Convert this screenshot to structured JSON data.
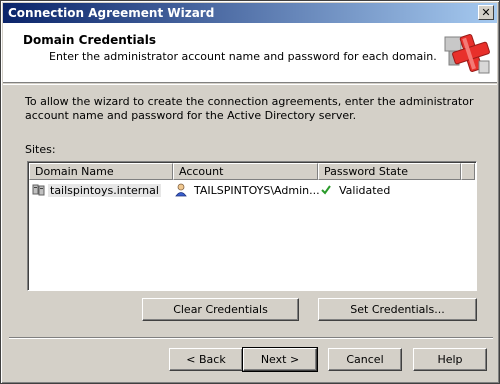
{
  "window": {
    "title": "Connection Agreement Wizard",
    "close_glyph": "✕"
  },
  "header": {
    "title": "Domain Credentials",
    "subtitle": "Enter the administrator account name and password for each domain.",
    "logo_icon": "exchange-wizard-logo-icon"
  },
  "body": {
    "instructions": "To allow the wizard to create the connection agreements, enter the administrator account name and password for the Active Directory server.",
    "sites_label": "Sites:"
  },
  "list": {
    "columns": [
      "Domain Name",
      "Account",
      "Password State"
    ],
    "rows": [
      {
        "domain": "tailspintoys.internal",
        "account": "TAILSPINTOYS\\Admin...",
        "state": "Validated",
        "domain_icon": "domain-icon",
        "account_icon": "user-icon",
        "state_icon": "checkmark-icon"
      }
    ]
  },
  "buttons": {
    "clear_credentials": "Clear Credentials",
    "set_credentials": "Set Credentials...",
    "back": "< Back",
    "next": "Next >",
    "cancel": "Cancel",
    "help": "Help"
  },
  "colors": {
    "titlebar_start": "#0a246a",
    "titlebar_end": "#a6caf0",
    "face": "#d4d0c8",
    "check_green": "#2a9a2a",
    "logo_red": "#e8302b"
  }
}
